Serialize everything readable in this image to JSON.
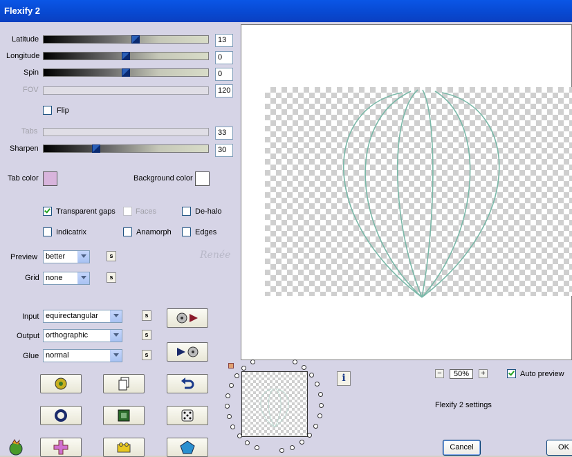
{
  "window": {
    "title": "Flexify 2"
  },
  "sliders": [
    {
      "label": "Latitude",
      "value": "13",
      "enabled": true,
      "level": 0.56
    },
    {
      "label": "Longitude",
      "value": "0",
      "enabled": true,
      "level": 0.5
    },
    {
      "label": "Spin",
      "value": "0",
      "enabled": true,
      "level": 0.5
    },
    {
      "label": "FOV",
      "value": "120",
      "enabled": false,
      "level": 0.0
    },
    {
      "label": "Tabs",
      "value": "33",
      "enabled": false,
      "level": 0.0
    },
    {
      "label": "Sharpen",
      "value": "30",
      "enabled": true,
      "level": 0.31
    }
  ],
  "flip": {
    "label": "Flip",
    "checked": false
  },
  "colors": {
    "tab_color_label": "Tab color",
    "tab_color": "#d8b4dc",
    "background_color_label": "Background color",
    "background_color": "#ffffff"
  },
  "options": {
    "transparent_gaps": {
      "label": "Transparent gaps",
      "checked": true
    },
    "faces": {
      "label": "Faces",
      "checked": false
    },
    "de_halo": {
      "label": "De-halo",
      "checked": false
    },
    "indicatrix": {
      "label": "Indicatrix",
      "checked": false
    },
    "anamorph": {
      "label": "Anamorph",
      "checked": false
    },
    "edges": {
      "label": "Edges",
      "checked": false
    }
  },
  "preview_select": {
    "label": "Preview",
    "value": "better"
  },
  "grid_select": {
    "label": "Grid",
    "value": "none"
  },
  "input_select": {
    "label": "Input",
    "value": "equirectangular"
  },
  "output_select": {
    "label": "Output",
    "value": "orthographic"
  },
  "glue_select": {
    "label": "Glue",
    "value": "normal"
  },
  "s_button_label": "s",
  "zoom": {
    "value": "50%",
    "minus": "−",
    "plus": "+"
  },
  "auto_preview": {
    "label": "Auto preview",
    "checked": true
  },
  "settings_label": "Flexify 2 settings",
  "info_label": "i",
  "buttons": {
    "cancel": "Cancel",
    "ok": "OK"
  },
  "watermark": {
    "text": "Renée"
  },
  "accent": "#2a5fb8"
}
